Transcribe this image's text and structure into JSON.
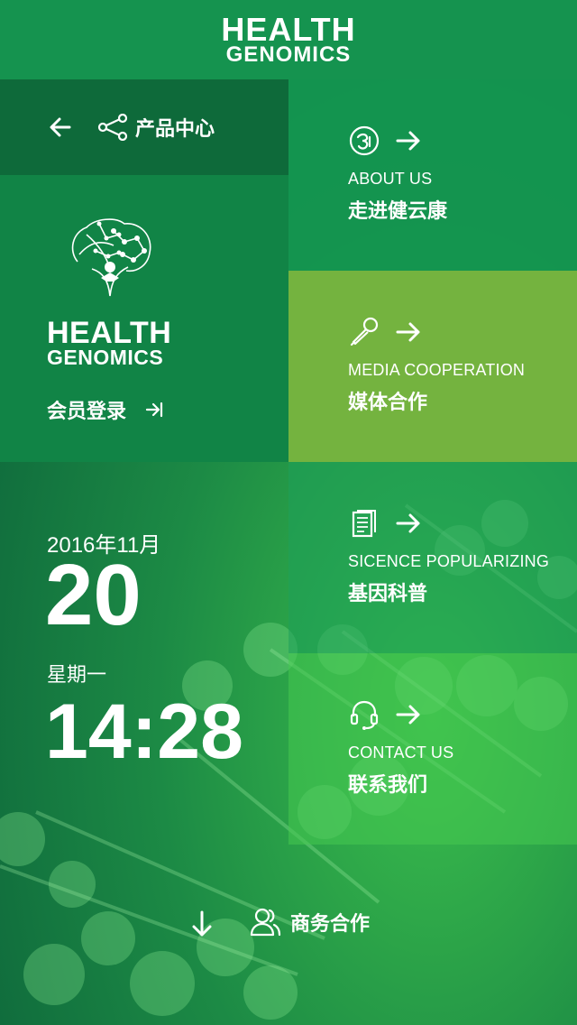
{
  "header": {
    "brand_line1": "HEALTH",
    "brand_line2": "GENOMICS"
  },
  "nav": {
    "title": "产品中心",
    "back_icon": "arrow-left-icon",
    "share_icon": "share-icon"
  },
  "member": {
    "brand_line1": "HEALTH",
    "brand_line2": "GENOMICS",
    "login_label": "会员登录",
    "login_icon": "login-arrow-icon"
  },
  "datetime": {
    "date": "2016年11月",
    "day": "20",
    "weekday": "星期一",
    "time": "14:28"
  },
  "tiles": [
    {
      "en": "ABOUT US",
      "cn": "走进健云康",
      "icon": "about-icon"
    },
    {
      "en": "MEDIA COOPERATION",
      "cn": "媒体合作",
      "icon": "microphone-icon"
    },
    {
      "en": "SICENCE POPULARIZING",
      "cn": "基因科普",
      "icon": "document-icon"
    },
    {
      "en": "CONTACT US",
      "cn": "联系我们",
      "icon": "headset-icon"
    }
  ],
  "footer": {
    "business_label": "商务合作",
    "down_icon": "arrow-down-icon",
    "people_icon": "people-icon"
  },
  "colors": {
    "header": "#15934f",
    "nav_bar": "#0e6a3a",
    "member_panel": "#118446",
    "about_tile": "#14964f",
    "media_tile": "#74b33f",
    "accent_light_green": "#3cbf4c"
  }
}
